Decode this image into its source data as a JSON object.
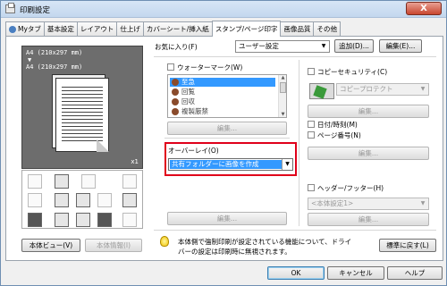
{
  "window": {
    "title": "印刷設定",
    "close_glyph": "X"
  },
  "tabs": [
    "Myタブ",
    "基本設定",
    "レイアウト",
    "仕上げ",
    "カバーシート/挿入紙",
    "スタンプ/ページ印字",
    "画像品質",
    "その他"
  ],
  "active_tab": "スタンプ/ページ印字",
  "favorites": {
    "label": "お気に入り(F)",
    "value": "ユーザー設定",
    "add_button": "追加(D)...",
    "edit_button": "編集(E)..."
  },
  "preview": {
    "line1": "A4 (210x297 mm)",
    "arrow": "▼",
    "line2": "A4 (210x297 mm)",
    "zoom": "x1",
    "printer_view_button": "本体ビュー(V)",
    "printer_info_button": "本体情報(I)"
  },
  "watermark": {
    "label": "ウォーターマーク(W)",
    "checked": false,
    "items": [
      "至急",
      "回覧",
      "回収",
      "複製厳禁"
    ],
    "selected_index": 0,
    "edit_button": "編集..."
  },
  "overlay": {
    "label": "オーバーレイ(O)",
    "value": "共有フォルダーに画像を作成",
    "edit_button": "編集..."
  },
  "copy_security": {
    "label": "コピーセキュリティ(C)",
    "checked": false,
    "value": "コピープロテクト",
    "edit_button": "編集..."
  },
  "date_time": {
    "label": "日付/時刻(M)",
    "checked": false
  },
  "page_number": {
    "label": "ページ番号(N)",
    "checked": false,
    "edit_button": "編集..."
  },
  "header_footer": {
    "label": "ヘッダー/フッター(H)",
    "checked": false,
    "value": "<本体設定1>",
    "edit_button": "編集..."
  },
  "notice": {
    "text_line1": "本体側で強制印刷が設定されている機能について、ドライ",
    "text_line2": "バーの設定は印刷時に無視されます。",
    "reset_button": "標準に戻す(L)"
  },
  "footer": {
    "ok": "OK",
    "cancel": "キャンセル",
    "help": "ヘルプ"
  }
}
